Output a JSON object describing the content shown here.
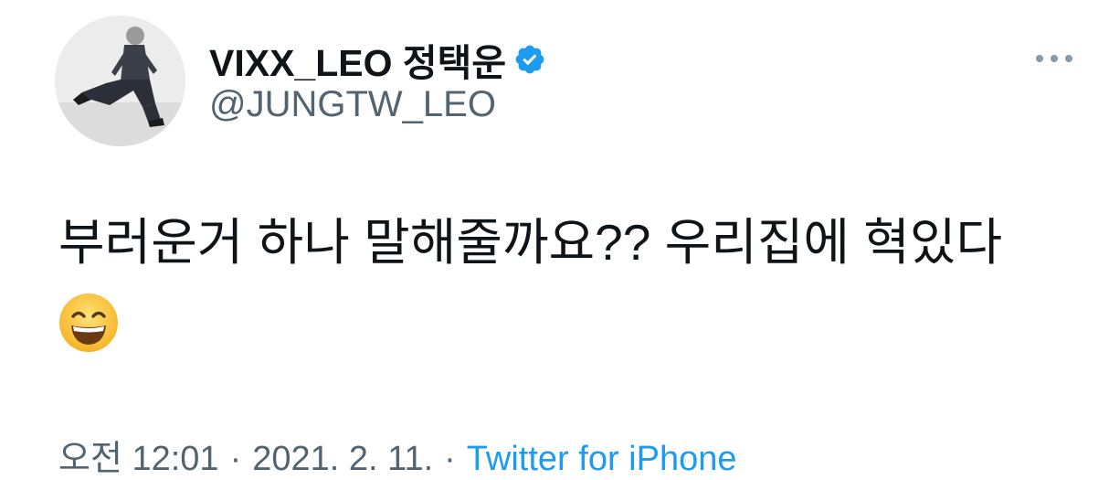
{
  "user": {
    "display_name": "VIXX_LEO 정택운",
    "handle": "@JUNGTW_LEO",
    "verified": true
  },
  "tweet": {
    "text": "부러운거 하나 말해줄까요?? 우리집에 혁있다",
    "emoji": "grinning-face-with-smiling-eyes"
  },
  "meta": {
    "time": "오전 12:01",
    "separator": "·",
    "date": "2021. 2. 11.",
    "source": "Twitter for iPhone"
  },
  "colors": {
    "verified_blue": "#1d9bf0",
    "link_blue": "#1d9bf0",
    "secondary_text": "#536471",
    "primary_text": "#0f1419"
  },
  "icons": {
    "more": "more-horizontal-icon",
    "verified": "verified-badge-icon"
  }
}
